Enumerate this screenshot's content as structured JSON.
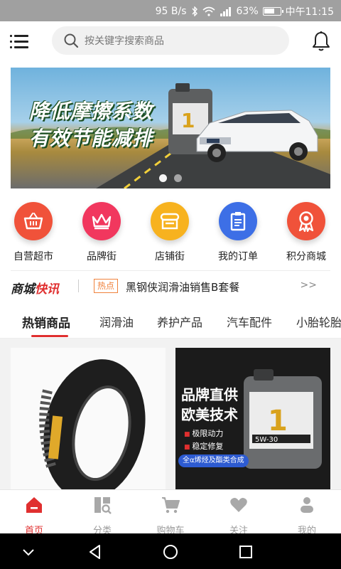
{
  "status_bar": {
    "net_speed": "95 B/s",
    "battery": "63%",
    "time": "中午11:15"
  },
  "header": {
    "search_placeholder": "按关键字搜索商品"
  },
  "banner": {
    "line1": "降低摩擦系数",
    "line2": "有效节能减排",
    "slide_count": 2,
    "active_slide": 1
  },
  "categories": [
    {
      "label": "自营超市",
      "icon": "basket-icon",
      "color": "#f0523a"
    },
    {
      "label": "品牌街",
      "icon": "crown-icon",
      "color": "#f1375e"
    },
    {
      "label": "店铺街",
      "icon": "store-icon",
      "color": "#f7b21f"
    },
    {
      "label": "我的订单",
      "icon": "order-list-icon",
      "color": "#3d6fe6"
    },
    {
      "label": "积分商城",
      "icon": "award-icon",
      "color": "#f0523a"
    }
  ],
  "news": {
    "logo_a": "商城",
    "logo_b": "快讯",
    "tag": "热点",
    "text": "黑钢侠润滑油销售B套餐",
    "more": ">>"
  },
  "tabs": [
    "热销商品",
    "润滑油",
    "养护产品",
    "汽车配件",
    "小胎轮胎"
  ],
  "active_tab": 0,
  "products": {
    "ad": {
      "title1": "品牌直供",
      "title2": "欧美技术",
      "bullet1": "极限动力",
      "bullet2": "稳定修复",
      "pill": "全α烯烃及酯类合成"
    }
  },
  "bottom_nav": [
    {
      "label": "首页",
      "icon": "home-icon",
      "active": true
    },
    {
      "label": "分类",
      "icon": "category-icon",
      "active": false
    },
    {
      "label": "购物车",
      "icon": "cart-icon",
      "active": false
    },
    {
      "label": "关注",
      "icon": "heart-icon",
      "active": false
    },
    {
      "label": "我的",
      "icon": "user-icon",
      "active": false
    }
  ],
  "colors": {
    "accent": "#e02f2f",
    "status_bar": "#a0a0a0",
    "news_tag": "#f0823c"
  }
}
